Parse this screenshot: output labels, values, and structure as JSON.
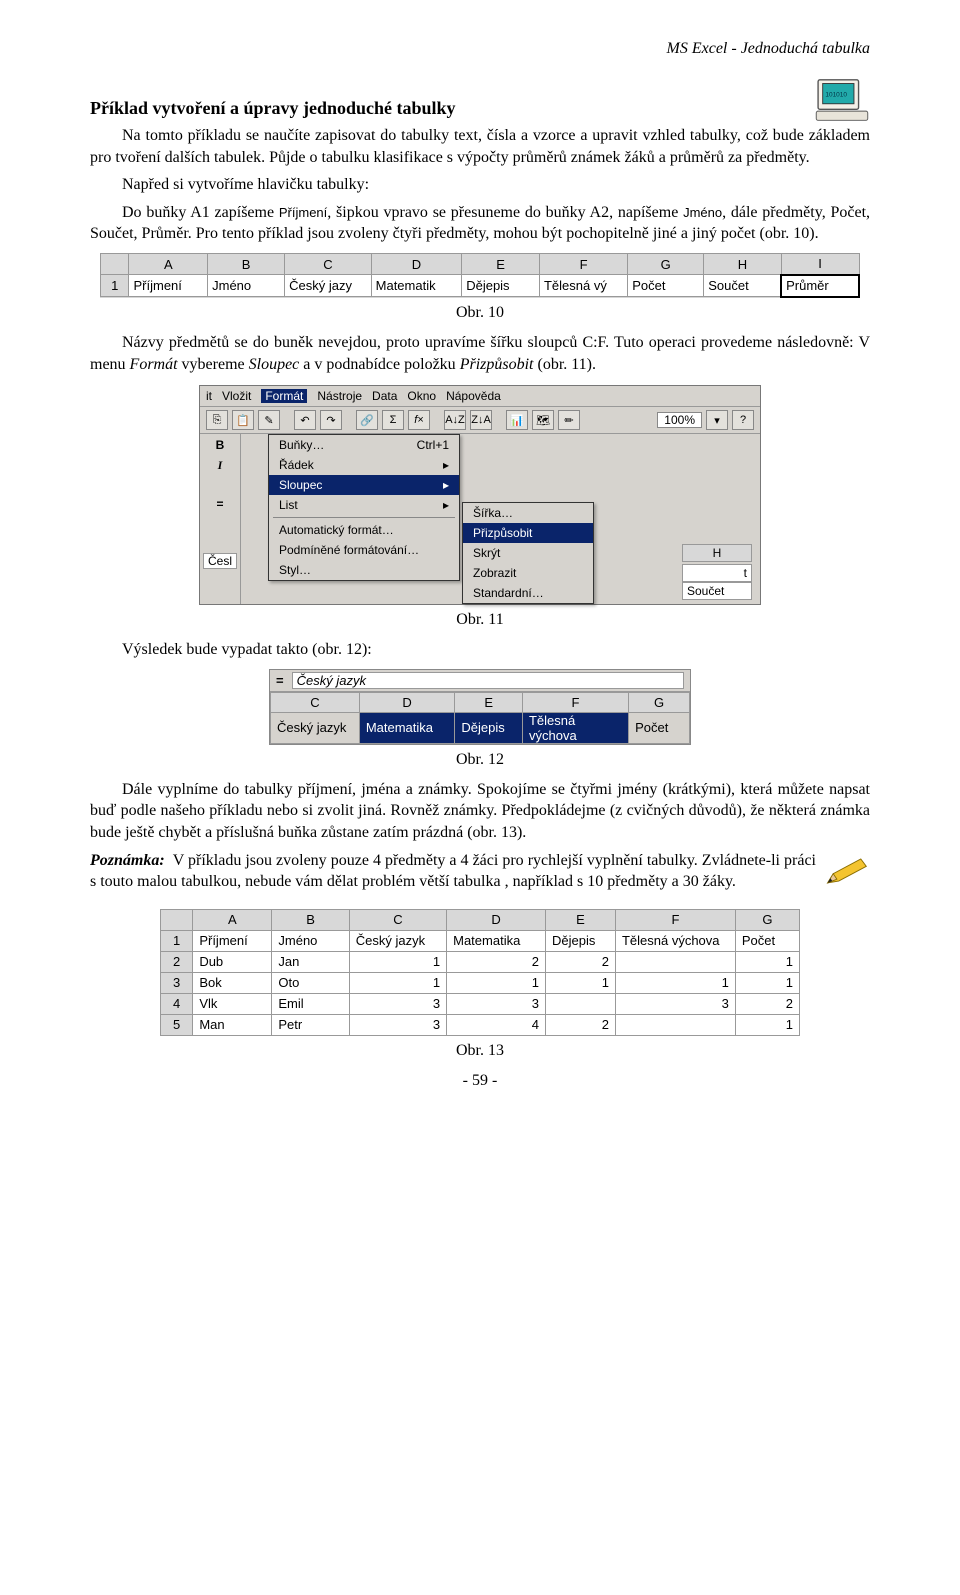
{
  "header": {
    "title": "MS Excel - Jednoduchá tabulka"
  },
  "section_title": "Příklad vytvoření a úpravy jednoduché tabulky",
  "p1": "Na tomto příkladu se naučíte zapisovat do tabulky text, čísla a vzorce a upravit vzhled tabulky, což bude základem pro tvoření dalších tabulek. Půjde o tabulku klasifikace s výpočty průměrů známek žáků a průměrů za předměty.",
  "p1b": "Napřed si vytvoříme hlavičku tabulky:",
  "p1c_a": "Do buňky A1 zapíšeme ",
  "p1c_b": "Příjmení",
  "p1c_c": ", šipkou vpravo se přesuneme do buňky A2, napíšeme ",
  "p1c_d": "Jméno",
  "p1c_e": ", dále předměty, Počet, Součet, Průměr. Pro tento příklad jsou zvoleny čtyři předměty, mohou být pochopitelně jiné a jiný počet (obr. 10).",
  "fig10": {
    "cols": [
      "A",
      "B",
      "C",
      "D",
      "E",
      "F",
      "G",
      "H",
      "I"
    ],
    "row": "1",
    "cells": [
      "Příjmení",
      "Jméno",
      "Český jazy",
      "Matematik",
      "Dějepis",
      "Tělesná vý",
      "Počet",
      "Součet",
      "Průměr"
    ]
  },
  "cap10": "Obr. 10",
  "p2_a": "Názvy předmětů se do buněk nevejdou, proto upravíme šířku sloupců C:F. Tuto operaci provedeme následovně: V menu ",
  "p2_b": "Formát",
  "p2_c": " vybereme ",
  "p2_d": "Sloupec",
  "p2_e": " a v podnabídce položku ",
  "p2_f": "Přizpůsobit",
  "p2_g": " (obr. 11).",
  "menu": {
    "bar": [
      "it",
      "Vložit",
      "Formát",
      "Nástroje",
      "Data",
      "Okno",
      "Nápověda"
    ],
    "zoom": "100%",
    "sort_az": "A↓Z",
    "sort_za": "Z↓A",
    "side": [
      "B",
      "I",
      "="
    ],
    "dd": {
      "bunky": "Buňky…",
      "bunky_short": "Ctrl+1",
      "radek": "Řádek",
      "sloupec": "Sloupec",
      "list": "List",
      "auto": "Automatický formát…",
      "podm": "Podmíněné formátování…",
      "styl": "Styl…"
    },
    "sub": {
      "sirka": "Šířka…",
      "prizp": "Přizpůsobit",
      "skryt": "Skrýt",
      "zobr": "Zobrazit",
      "std": "Standardní…"
    },
    "right": {
      "H": "H",
      "soucet": "Součet",
      "t": "t"
    },
    "cesl": "Česl"
  },
  "cap11": "Obr. 11",
  "p3": "Výsledek bude vypadat takto (obr. 12):",
  "fig12": {
    "formula_label": "=",
    "formula_val": "Český jazyk",
    "cols": [
      "C",
      "D",
      "E",
      "F",
      "G"
    ],
    "cells": [
      "Český jazyk",
      "Matematika",
      "Dějepis",
      "Tělesná výchova",
      "Počet"
    ]
  },
  "cap12": "Obr. 12",
  "p4": "Dále vyplníme do tabulky příjmení, jména a známky. Spokojíme se čtyřmi jmény (krátkými), která můžete napsat buď podle našeho příkladu nebo si zvolit jiná. Rovněž známky. Předpokládejme (z cvičných důvodů), že některá známka bude ještě chybět a příslušná buňka zůstane zatím prázdná (obr. 13).",
  "note_label": "Poznámka:",
  "note_text": "V příkladu jsou zvoleny pouze 4 předměty a 4 žáci pro rychlejší vyplnění tabulky. Zvládnete-li práci s touto malou tabulkou, nebude vám dělat problém větší tabulka , například s 10 předměty a 30 žáky.",
  "fig13": {
    "cols": [
      "A",
      "B",
      "C",
      "D",
      "E",
      "F",
      "G"
    ],
    "rows": [
      {
        "n": "1",
        "c": [
          "Příjmení",
          "Jméno",
          "Český jazyk",
          "Matematika",
          "Dějepis",
          "Tělesná výchova",
          "Počet"
        ]
      },
      {
        "n": "2",
        "c": [
          "Dub",
          "Jan",
          "1",
          "2",
          "2",
          "",
          "1"
        ]
      },
      {
        "n": "3",
        "c": [
          "Bok",
          "Oto",
          "1",
          "1",
          "1",
          "1",
          "1"
        ]
      },
      {
        "n": "4",
        "c": [
          "Vlk",
          "Emil",
          "3",
          "3",
          "",
          "3",
          "2"
        ]
      },
      {
        "n": "5",
        "c": [
          "Man",
          "Petr",
          "3",
          "4",
          "2",
          "",
          "1"
        ]
      }
    ]
  },
  "cap13": "Obr. 13",
  "pagenum": "- 59 -"
}
